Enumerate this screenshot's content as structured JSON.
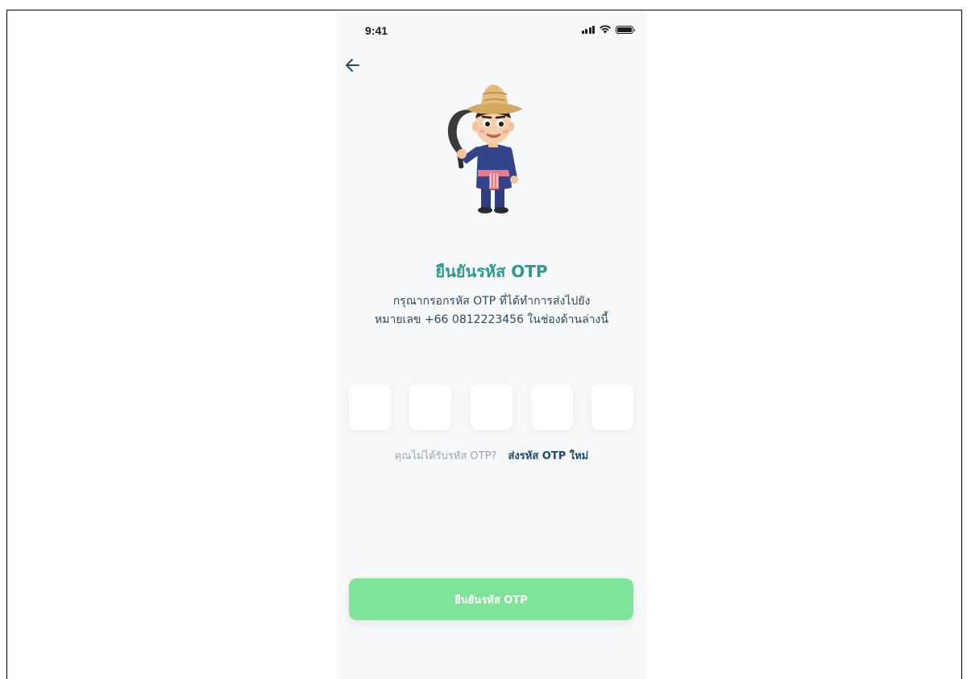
{
  "status_bar": {
    "time": "9:41"
  },
  "icons": {
    "back": "arrow-left-icon",
    "signal": "signal-bars-icon",
    "wifi": "wifi-icon",
    "battery": "battery-icon"
  },
  "colors": {
    "title": "#2e9a8e",
    "text": "#2c4a5c",
    "hint": "#98a7b3",
    "link": "#1f4a66",
    "button": "#7ee498",
    "background": "#f7f8fa"
  },
  "otp": {
    "title": "ยืนยันรหัส OTP",
    "description_line1": "กรุณากรอกรหัส OTP ที่ได้ทำการส่งไปยัง",
    "description_line2": "หมายเลข +66 0812223456 ในช่องด้านล่างนี้",
    "digits": [
      "",
      "",
      "",
      "",
      ""
    ],
    "resend_hint": "คุณไม่ได้รับรหัส OTP?",
    "resend_link": "ส่งรหัส OTP ใหม่",
    "confirm_label": "ยืนยันรหัส OTP"
  }
}
